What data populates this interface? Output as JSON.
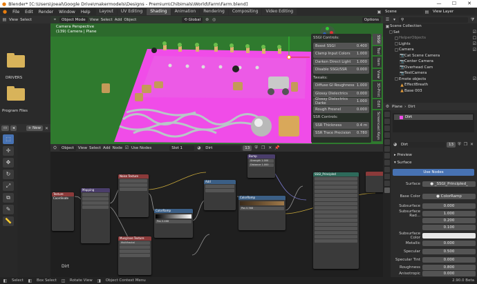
{
  "window": {
    "title": "Blender* [C:\\Users\\joeal\\Google Drive\\makermodels\\Designs - Premium\\Chibimals\\World\\Farm\\Farm.blend]",
    "controls": [
      "—",
      "☐",
      "✕"
    ]
  },
  "menu": {
    "items": [
      "File",
      "Edit",
      "Render",
      "Window",
      "Help"
    ],
    "workspaces": [
      "Layout",
      "UV Editing",
      "Shading",
      "Animation",
      "Rendering",
      "Compositing",
      "Video Editing"
    ],
    "active_workspace": "Shading",
    "scene": "Scene",
    "view_layer": "View Layer"
  },
  "filebrowser": {
    "view": "View",
    "select": "Select",
    "folders": [
      "DRIVERS",
      "Program Files"
    ],
    "new_label": "New"
  },
  "viewport": {
    "mode": "Object Mode",
    "menus": [
      "View",
      "Select",
      "Add",
      "Object"
    ],
    "orientation": "Global",
    "options": "Options",
    "info_line1": "Camera Perspective",
    "info_line2": "(139) Camera | Plane"
  },
  "ssgi": {
    "title": "SSGI Controls:",
    "rows": [
      {
        "label": "Boost SSGI",
        "value": "0.400"
      },
      {
        "label": "Clamp Input Colors",
        "value": "1.000"
      },
      {
        "label": "Darken Direct Light",
        "value": "1.000"
      },
      {
        "label": "Disable SSGI/SSR",
        "value": "0.000"
      }
    ],
    "tweaks_title": "Tweaks:",
    "tweaks": [
      {
        "label": "Diffuse GI Roughness",
        "value": "1.000"
      },
      {
        "label": "Glossy Dielectrics",
        "value": "0.000"
      },
      {
        "label": "Glossy Dielectrics Darke",
        "value": "1.000"
      },
      {
        "label": "Rough Fresnel",
        "value": "0.000"
      }
    ],
    "ssr_title": "SSR Controls:",
    "ssr": [
      {
        "label": "SSR Thickness",
        "value": "0.4 m"
      },
      {
        "label": "SSR Trace Precision",
        "value": "0.780"
      }
    ]
  },
  "sidetabs": [
    "SSGI",
    "Tool",
    "Item",
    "View",
    "3D-Print",
    "Edit",
    "Screencast Keys"
  ],
  "nodeeditor": {
    "type": "Object",
    "menus": [
      "View",
      "Select",
      "Add",
      "Node"
    ],
    "use_nodes": "Use Nodes",
    "slot": "Slot 1",
    "material": "Dirt",
    "users": "13",
    "label": "Dirt",
    "nodes": {
      "mapping": "Mapping",
      "texcoord": "Texture Coordinate",
      "noise": "Noise Texture",
      "colorramp1": "ColorRamp",
      "musgrave": "Musgrave Texture",
      "bump": "Bump",
      "strength": "Strength",
      "strength_val": "1.000",
      "distance": "Distance",
      "distance_val": "1.000",
      "add": "Add",
      "value": "Value",
      "colorramp2": "ColorRamp",
      "pos": "Pos",
      "pos_val": "0.368",
      "pos_val2": "0.468",
      "ssgi_node": "SSGI_Principled",
      "musgrave_type": "Multifractal",
      "fac": "Fac",
      "color": "Color",
      "height": "Height",
      "normal": "Normal"
    }
  },
  "outliner": {
    "title": "Scene Collection",
    "items": [
      {
        "name": "Set",
        "icon": "collection-icon"
      },
      {
        "name": "HelperObjects",
        "icon": "collection-icon"
      },
      {
        "name": "Lights",
        "icon": "collection-icon"
      },
      {
        "name": "Camera",
        "icon": "collection-icon"
      },
      {
        "name": "Cat Scene Camera",
        "icon": "camera-icon"
      },
      {
        "name": "Center Camera",
        "icon": "camera-icon"
      },
      {
        "name": "Overhead Cam",
        "icon": "camera-icon"
      },
      {
        "name": "TestCamera",
        "icon": "camera-icon"
      },
      {
        "name": "Emote objects",
        "icon": "collection-icon"
      },
      {
        "name": "EffectBreath",
        "icon": "object-icon"
      },
      {
        "name": "Base 003",
        "icon": "object-icon"
      }
    ]
  },
  "properties": {
    "breadcrumb_object": "Plane",
    "breadcrumb_material": "Dirt",
    "slot": "Dirt",
    "material": "Dirt",
    "users": "13",
    "preview": "Preview",
    "surface": "Surface",
    "use_nodes": "Use Nodes",
    "surface_value": "_SSGI_Principled_",
    "base_color_label": "Base Color",
    "base_color_value": "ColorRamp",
    "fields": [
      {
        "label": "Subsurface",
        "value": "0.000"
      },
      {
        "label": "Subsurface Rad...",
        "value": "1.000"
      },
      {
        "label": "",
        "value": "0.200"
      },
      {
        "label": "",
        "value": "0.100"
      },
      {
        "label": "Subsurface Color",
        "value": ""
      },
      {
        "label": "Metallic",
        "value": "0.000"
      },
      {
        "label": "Specular",
        "value": "0.500"
      },
      {
        "label": "Specular Tint",
        "value": "0.000"
      },
      {
        "label": "Roughness",
        "value": "0.800"
      },
      {
        "label": "Anisotropic",
        "value": "0.000"
      }
    ]
  },
  "status": {
    "items": [
      "Select",
      "Box Select",
      "Rotate View",
      "Object Context Menu"
    ],
    "version": "2.90.0 Beta"
  },
  "colors": {
    "accent": "#4772b3",
    "magenta": "#f04ce8",
    "grass": "#2f7a2e",
    "header": "#303030",
    "node_teal": "#2d6a5a",
    "node_blue": "#3b5f86",
    "node_red": "#8b3a3a",
    "node_purple": "#4a3d6b"
  }
}
